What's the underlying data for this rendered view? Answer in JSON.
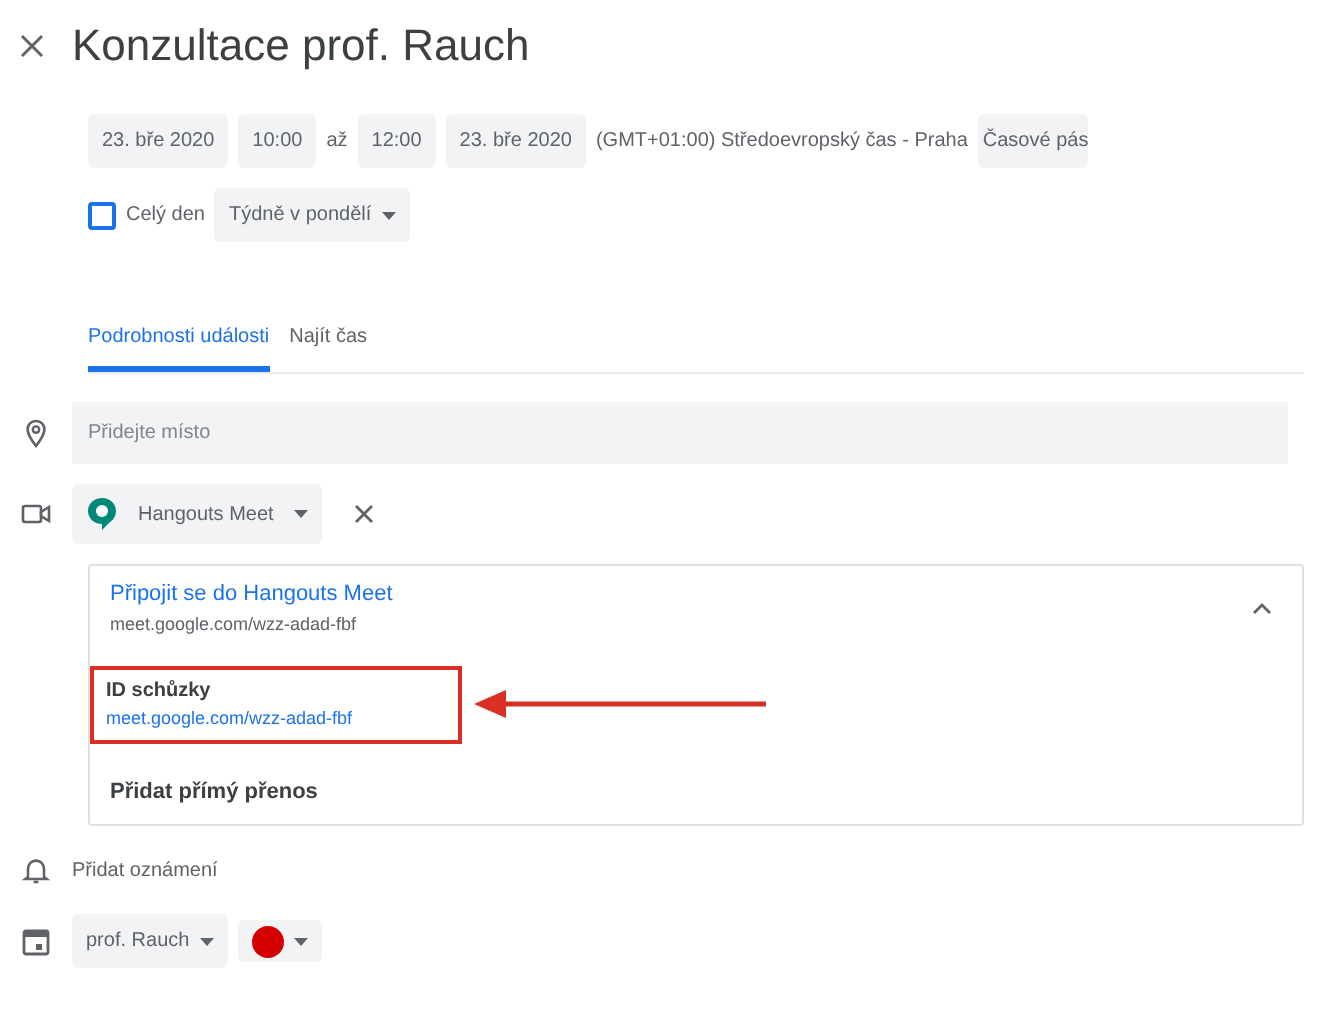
{
  "title": "Konzultace prof. Rauch",
  "when": {
    "start_date": "23. bře 2020",
    "start_time": "10:00",
    "separator": "až",
    "end_time": "12:00",
    "end_date": "23. bře 2020",
    "timezone": "(GMT+01:00) Středoevropský čas - Praha",
    "timezone_button": "Časové pás"
  },
  "all_day": {
    "label": "Celý den",
    "checked": false
  },
  "recurrence": "Týdně v pondělí",
  "tabs": [
    {
      "label": "Podrobnosti události",
      "selected": true
    },
    {
      "label": "Najít čas",
      "selected": false
    }
  ],
  "location": {
    "placeholder": "Přidejte místo"
  },
  "conference": {
    "provider": "Hangouts Meet",
    "expanded": true,
    "join": {
      "label": "Připojit se do Hangouts Meet",
      "url": "meet.google.com/wzz-adad-fbf"
    },
    "meeting_id": {
      "label": "ID schůzky",
      "url": "meet.google.com/wzz-adad-fbf",
      "highlighted": true
    },
    "live_stream": "Přidat přímý přenos"
  },
  "notification": "Přidat oznámení",
  "calendar": {
    "owner": "prof. Rauch",
    "color": "#d50000"
  }
}
